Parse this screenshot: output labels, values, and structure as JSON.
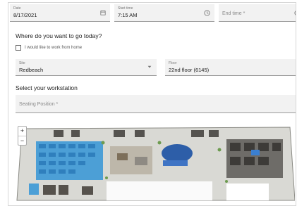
{
  "datetime": {
    "date": {
      "label": "Date",
      "value": "8/17/2021",
      "icon": "calendar-icon"
    },
    "start_time": {
      "label": "Start time",
      "value": "7:15 AM",
      "icon": "clock-icon"
    },
    "end_time": {
      "placeholder": "End time *",
      "icon": "clock-icon"
    }
  },
  "where": {
    "title": "Where do you want to go today?",
    "work_from_home_label": "I would like to work from home",
    "site": {
      "label": "Site",
      "value": "Redbeach",
      "icon": "chevron-down-icon"
    },
    "floor": {
      "label": "Floor",
      "value": "22nd floor (6145)"
    }
  },
  "workstation": {
    "title": "Select your workstation",
    "seating_placeholder": "Seating Position *"
  },
  "map": {
    "zoom_in": "+",
    "zoom_out": "−"
  }
}
